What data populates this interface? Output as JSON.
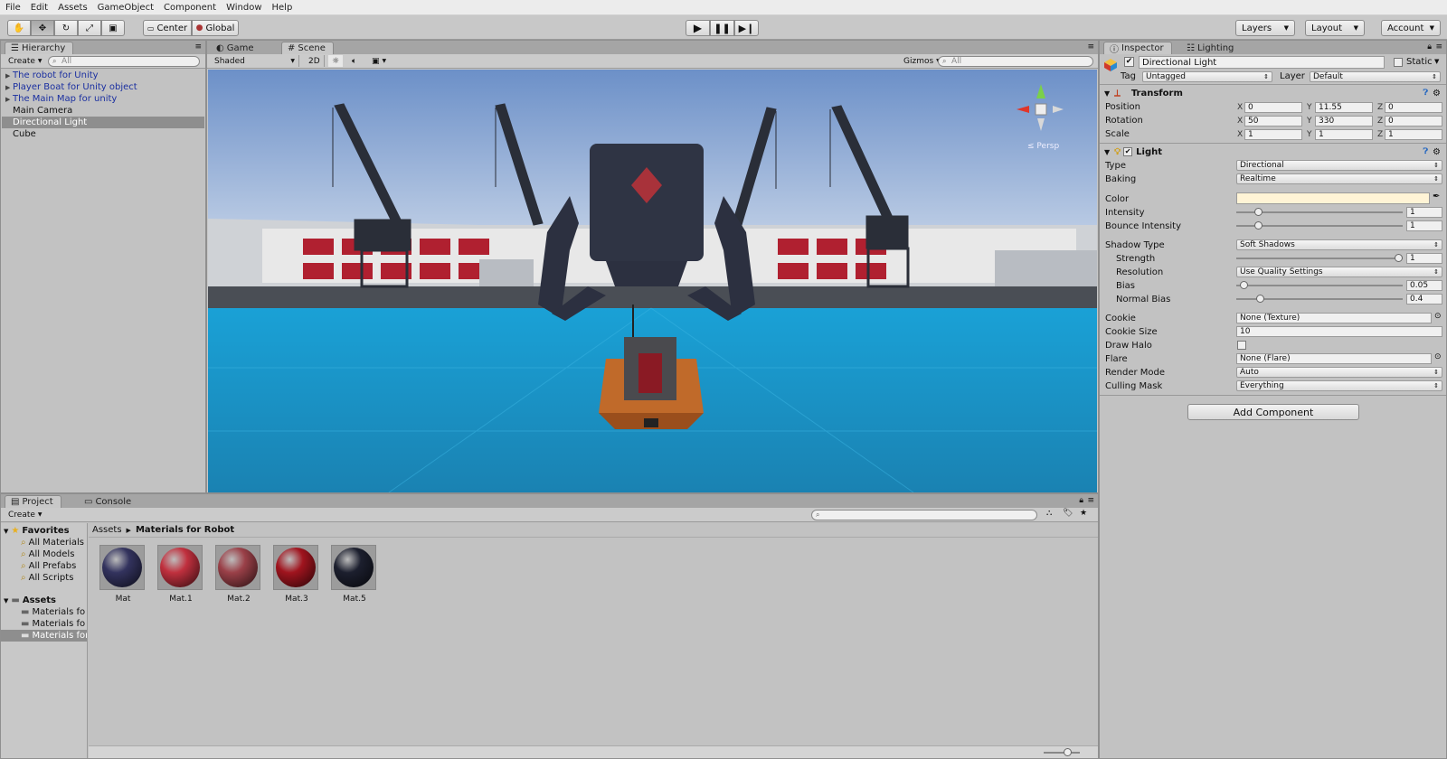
{
  "menu": [
    "File",
    "Edit",
    "Assets",
    "GameObject",
    "Component",
    "Window",
    "Help"
  ],
  "toolbar": {
    "center_label": "Center",
    "global_label": "Global",
    "layers_label": "Layers",
    "layout_label": "Layout",
    "account_label": "Account"
  },
  "hierarchy": {
    "tab": "Hierarchy",
    "create": "Create",
    "search_placeholder": "All",
    "items": [
      {
        "label": "The robot for Unity",
        "prefab": true
      },
      {
        "label": "Player Boat for Unity object",
        "prefab": true
      },
      {
        "label": "The  Main Map for unity",
        "prefab": true
      },
      {
        "label": "Main Camera",
        "prefab": false
      },
      {
        "label": "Directional Light",
        "prefab": false
      },
      {
        "label": "Cube",
        "prefab": false
      }
    ]
  },
  "scene": {
    "tab_game": "Game",
    "tab_scene": "Scene",
    "shading": "Shaded",
    "mode_2d": "2D",
    "gizmos": "Gizmos",
    "search_placeholder": "All",
    "persp_label": "Persp"
  },
  "inspector": {
    "tab": "Inspector",
    "tab_lighting": "Lighting",
    "object_name": "Directional Light",
    "static_label": "Static",
    "tag_label": "Tag",
    "tag_value": "Untagged",
    "layer_label": "Layer",
    "layer_value": "Default",
    "transform": {
      "title": "Transform",
      "position_label": "Position",
      "rotation_label": "Rotation",
      "scale_label": "Scale",
      "position": [
        "0",
        "11.55",
        "0"
      ],
      "rotation": [
        "50",
        "330",
        "0"
      ],
      "scale": [
        "1",
        "1",
        "1"
      ]
    },
    "light": {
      "title": "Light",
      "type_label": "Type",
      "type_value": "Directional",
      "baking_label": "Baking",
      "baking_value": "Realtime",
      "color_label": "Color",
      "color_value": "#fff4d6",
      "intensity_label": "Intensity",
      "intensity_value": "1",
      "bounce_label": "Bounce Intensity",
      "bounce_value": "1",
      "shadow_label": "Shadow Type",
      "shadow_value": "Soft Shadows",
      "strength_label": "Strength",
      "strength_value": "1",
      "resolution_label": "Resolution",
      "resolution_value": "Use Quality Settings",
      "bias_label": "Bias",
      "bias_value": "0.05",
      "normal_bias_label": "Normal Bias",
      "normal_bias_value": "0.4",
      "cookie_label": "Cookie",
      "cookie_value": "None (Texture)",
      "cookie_size_label": "Cookie Size",
      "cookie_size_value": "10",
      "draw_halo_label": "Draw Halo",
      "flare_label": "Flare",
      "flare_value": "None (Flare)",
      "render_mode_label": "Render Mode",
      "render_mode_value": "Auto",
      "culling_label": "Culling Mask",
      "culling_value": "Everything"
    },
    "add_component": "Add Component"
  },
  "project": {
    "tab": "Project",
    "tab_console": "Console",
    "create": "Create",
    "favorites_label": "Favorites",
    "favorites": [
      "All Materials",
      "All Models",
      "All Prefabs",
      "All Scripts"
    ],
    "assets_label": "Assets",
    "asset_folders": [
      "Materials for",
      "Materials for",
      "Materials for"
    ],
    "breadcrumb_root": "Assets",
    "breadcrumb_current": "Materials for Robot",
    "materials": [
      {
        "name": "Mat",
        "color": "#33335e"
      },
      {
        "name": "Mat.1",
        "color": "#c0303e"
      },
      {
        "name": "Mat.2",
        "color": "#9a4048"
      },
      {
        "name": "Mat.3",
        "color": "#a0141e"
      },
      {
        "name": "Mat.5",
        "color": "#1c1f2e"
      }
    ]
  }
}
